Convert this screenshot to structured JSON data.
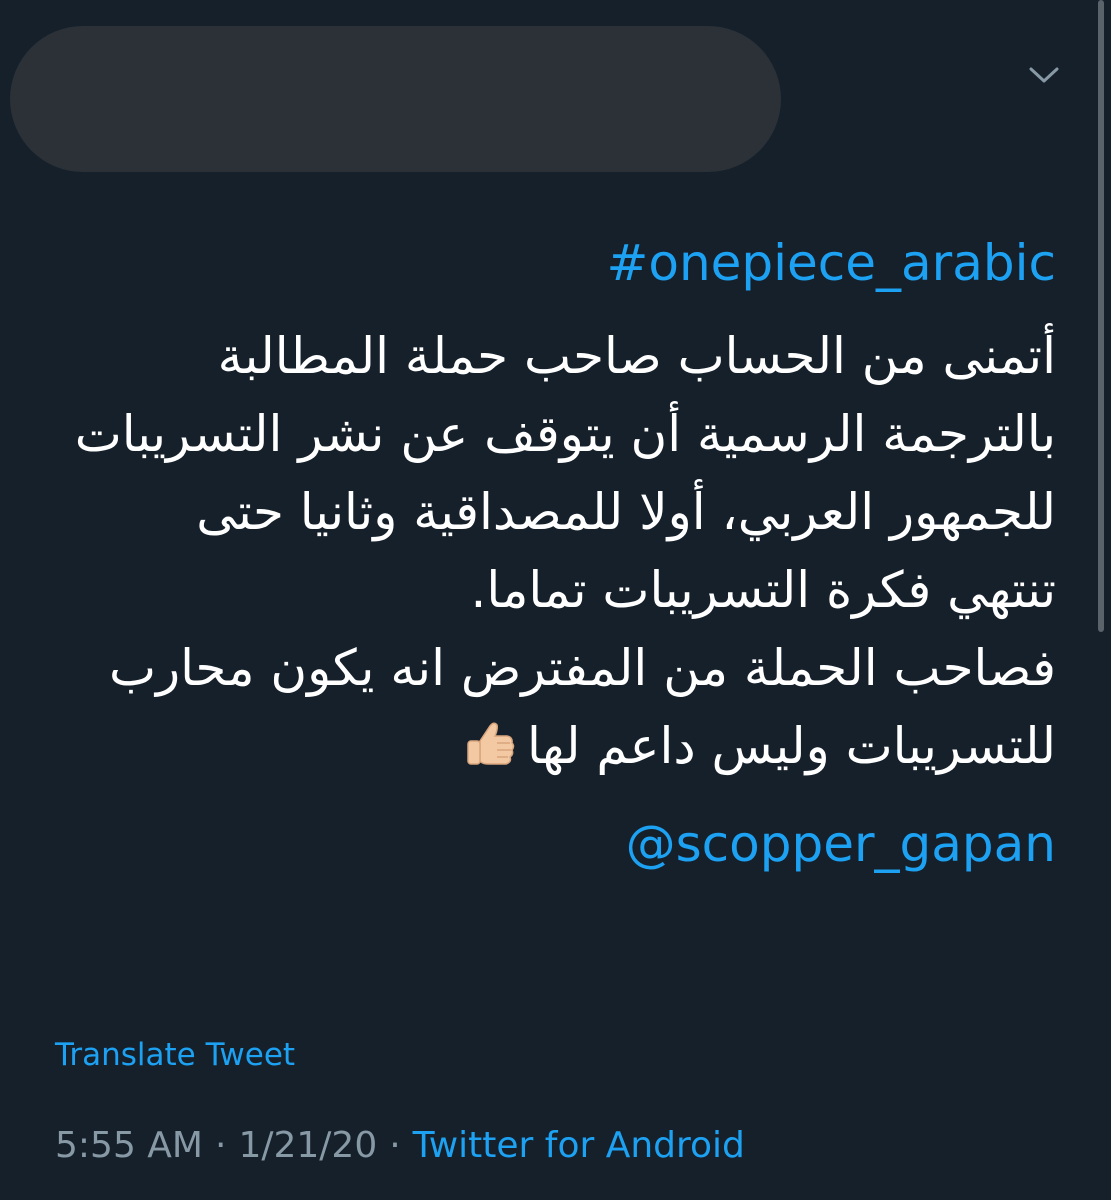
{
  "tweet": {
    "hashtag": "#onepiece_arabic",
    "lines": [
      "أتمنى من الحساب صاحب حملة المطالبة",
      "بالترجمة الرسمية أن يتوقف عن نشر التسريبات",
      "للجمهور العربي، أولا للمصداقية وثانيا حتى",
      "تنتهي فكرة التسريبات تماما.",
      "فصاحب الحملة من المفترض انه يكون محارب",
      "للتسريبات وليس داعم لها"
    ],
    "emoji": "thumbs-up",
    "mention": "@scopper_gapan"
  },
  "translate_label": "Translate Tweet",
  "meta": {
    "time": "5:55 AM",
    "date": "1/21/20",
    "separator": "·",
    "source": "Twitter for Android"
  },
  "icons": {
    "menu": "chevron-down-icon"
  },
  "colors": {
    "background": "#15202b",
    "text": "#ffffff",
    "accent": "#1da1f2",
    "muted": "#8899a6",
    "redacted": "#2b3137"
  }
}
